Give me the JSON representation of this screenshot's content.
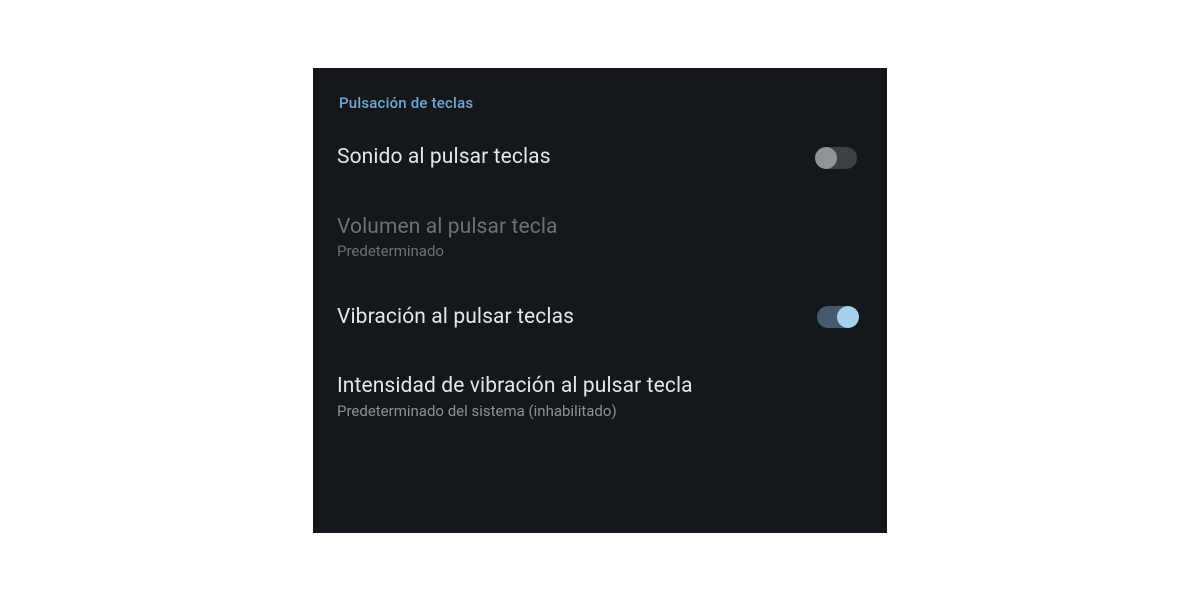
{
  "section": {
    "header": "Pulsación de teclas",
    "items": [
      {
        "title": "Sonido al pulsar teclas",
        "subtitle": "",
        "control": "switch",
        "state": "off",
        "enabled": true
      },
      {
        "title": "Volumen al pulsar tecla",
        "subtitle": "Predeterminado",
        "control": "link",
        "enabled": false
      },
      {
        "title": "Vibración al pulsar teclas",
        "subtitle": "",
        "control": "switch",
        "state": "on",
        "enabled": true
      },
      {
        "title": "Intensidad de vibración al pulsar tecla",
        "subtitle": "Predeterminado del sistema (inhabilitado)",
        "control": "link",
        "enabled": true
      }
    ]
  },
  "colors": {
    "panel_bg": "#14171b",
    "accent": "#6fa7d6",
    "switch_on_thumb": "#a7d0ec",
    "switch_on_track": "#455a6d"
  }
}
